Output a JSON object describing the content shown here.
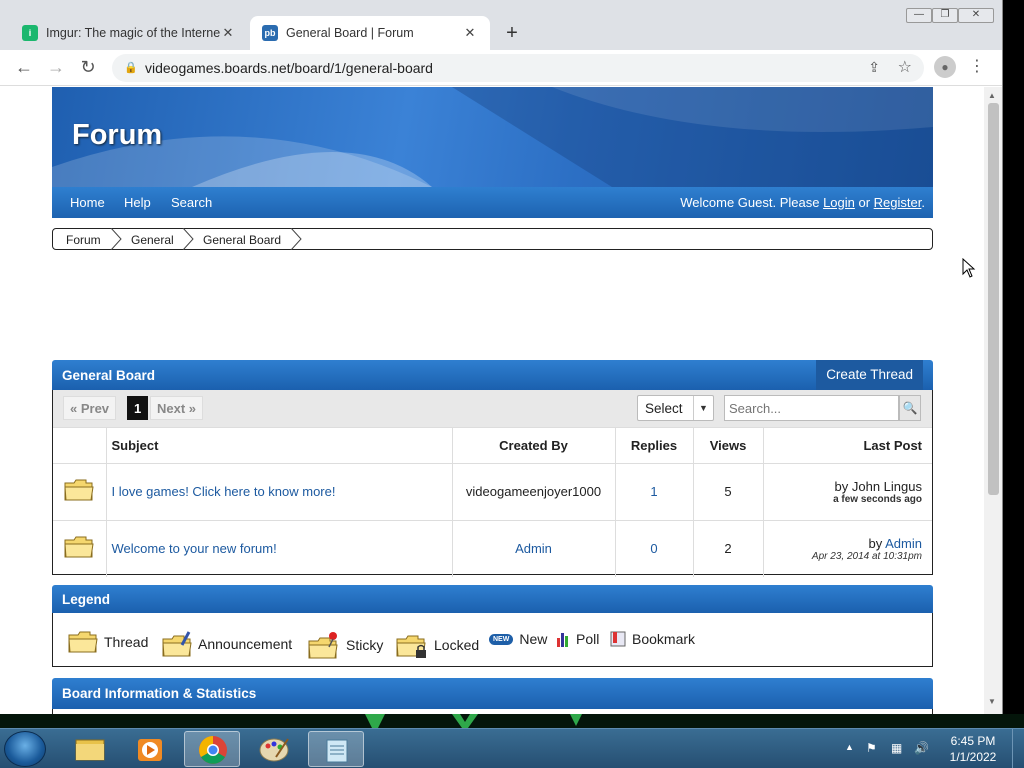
{
  "browser": {
    "tabs": [
      {
        "title": "Imgur: The magic of the Internet",
        "active": false
      },
      {
        "title": "General Board | Forum",
        "active": true
      }
    ],
    "url": "videogames.boards.net/board/1/general-board"
  },
  "forum": {
    "title": "Forum",
    "nav": {
      "home": "Home",
      "help": "Help",
      "search": "Search"
    },
    "welcome": {
      "prefix": "Welcome Guest. Please ",
      "login": "Login",
      "or": " or ",
      "register": "Register",
      "suffix": "."
    },
    "breadcrumb": [
      "Forum",
      "General",
      "General Board"
    ]
  },
  "board": {
    "title": "General Board",
    "create_thread": "Create Thread",
    "pager": {
      "prev": "« Prev",
      "current": "1",
      "next": "Next »"
    },
    "select_label": "Select",
    "search_placeholder": "Search...",
    "columns": {
      "subject": "Subject",
      "created_by": "Created By",
      "replies": "Replies",
      "views": "Views",
      "last_post": "Last Post"
    },
    "threads": [
      {
        "subject": "I love games! Click here to know more!",
        "created_by": "videogameenjoyer1000",
        "replies": "1",
        "views": "5",
        "last_by_prefix": "by ",
        "last_by": "John Lingus",
        "last_when": "a few seconds ago"
      },
      {
        "subject": "Welcome to your new forum!",
        "created_by": "Admin",
        "replies": "0",
        "views": "2",
        "last_by_prefix": "by ",
        "last_by": "Admin",
        "last_when": "Apr 23, 2014 at 10:31pm"
      }
    ]
  },
  "legend": {
    "title": "Legend",
    "items": [
      "Thread",
      "Announcement",
      "Sticky",
      "Locked",
      "New",
      "Poll",
      "Bookmark"
    ],
    "new_badge": "NEW"
  },
  "stats": {
    "title": "Board Information & Statistics"
  },
  "taskbar": {
    "time": "6:45 PM",
    "date": "1/1/2022"
  }
}
